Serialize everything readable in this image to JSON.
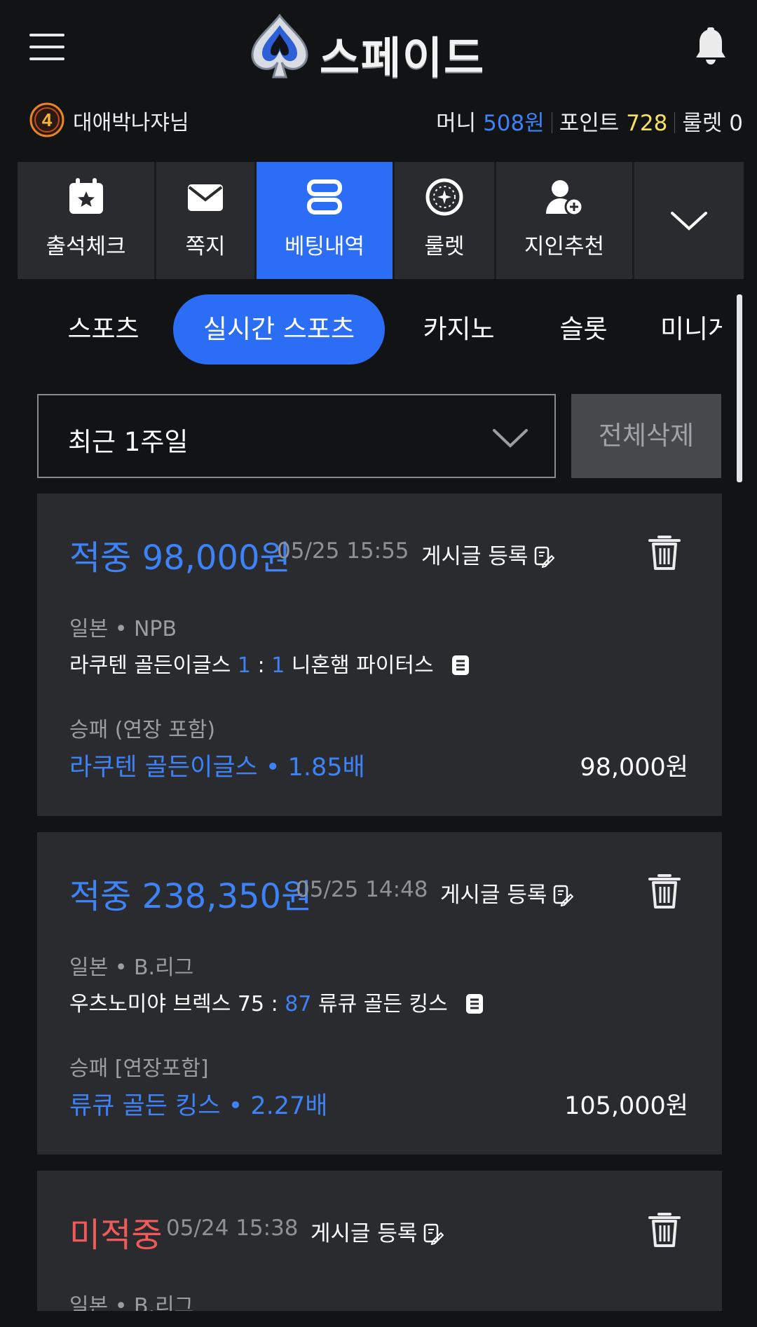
{
  "header": {
    "logo_text": "스페이드"
  },
  "user": {
    "level": "4",
    "name": "대애박나쟈님",
    "money_label": "머니",
    "money_value": "508원",
    "point_label": "포인트",
    "point_value": "728",
    "roulette_label": "룰렛",
    "roulette_value": "0"
  },
  "quickmenu": [
    {
      "label": "출석체크",
      "icon": "calendar-star-icon"
    },
    {
      "label": "쪽지",
      "icon": "envelope-icon"
    },
    {
      "label": "베팅내역",
      "icon": "list-icon",
      "active": true
    },
    {
      "label": "룰렛",
      "icon": "roulette-icon"
    },
    {
      "label": "지인추천",
      "icon": "user-plus-icon"
    }
  ],
  "categories": [
    "스포츠",
    "실시간 스포츠",
    "카지노",
    "슬롯",
    "미니게"
  ],
  "active_category": "실시간 스포츠",
  "filter": {
    "period": "최근 1주일",
    "delete_all": "전체삭제"
  },
  "bets": [
    {
      "result": "적중 98,000원",
      "status": "win",
      "datetime": "05/25 15:55",
      "post_label": "게시글 등록",
      "league": "일본  •  NPB",
      "home": "라쿠텐 골든이글스",
      "home_score": "1",
      "sep": ":",
      "away_score": "1",
      "away": "니혼햄 파이터스",
      "market": "승패 (연장 포함)",
      "pick": "라쿠텐 골든이글스  •  1.85배",
      "amount": "98,000원"
    },
    {
      "result": "적중 238,350원",
      "status": "win",
      "datetime": "05/25 14:48",
      "post_label": "게시글 등록",
      "league": "일본  •  B.리그",
      "home": "우츠노미야 브렉스",
      "home_score": "75",
      "sep": ":",
      "away_score": "87",
      "away": "류큐 골든 킹스",
      "market": "승패 [연장포함]",
      "pick": "류큐 골든 킹스  •  2.27배",
      "amount": "105,000원"
    },
    {
      "result": "미적중",
      "status": "lose",
      "datetime": "05/24 15:38",
      "post_label": "게시글 등록",
      "league": "일본  •  B.리그"
    }
  ],
  "colors": {
    "accent": "#2b6ef5",
    "win": "#3d82f7",
    "lose": "#ef5a5a",
    "point": "#f6e05e",
    "background": "#121315",
    "card": "#2a2b2f"
  }
}
